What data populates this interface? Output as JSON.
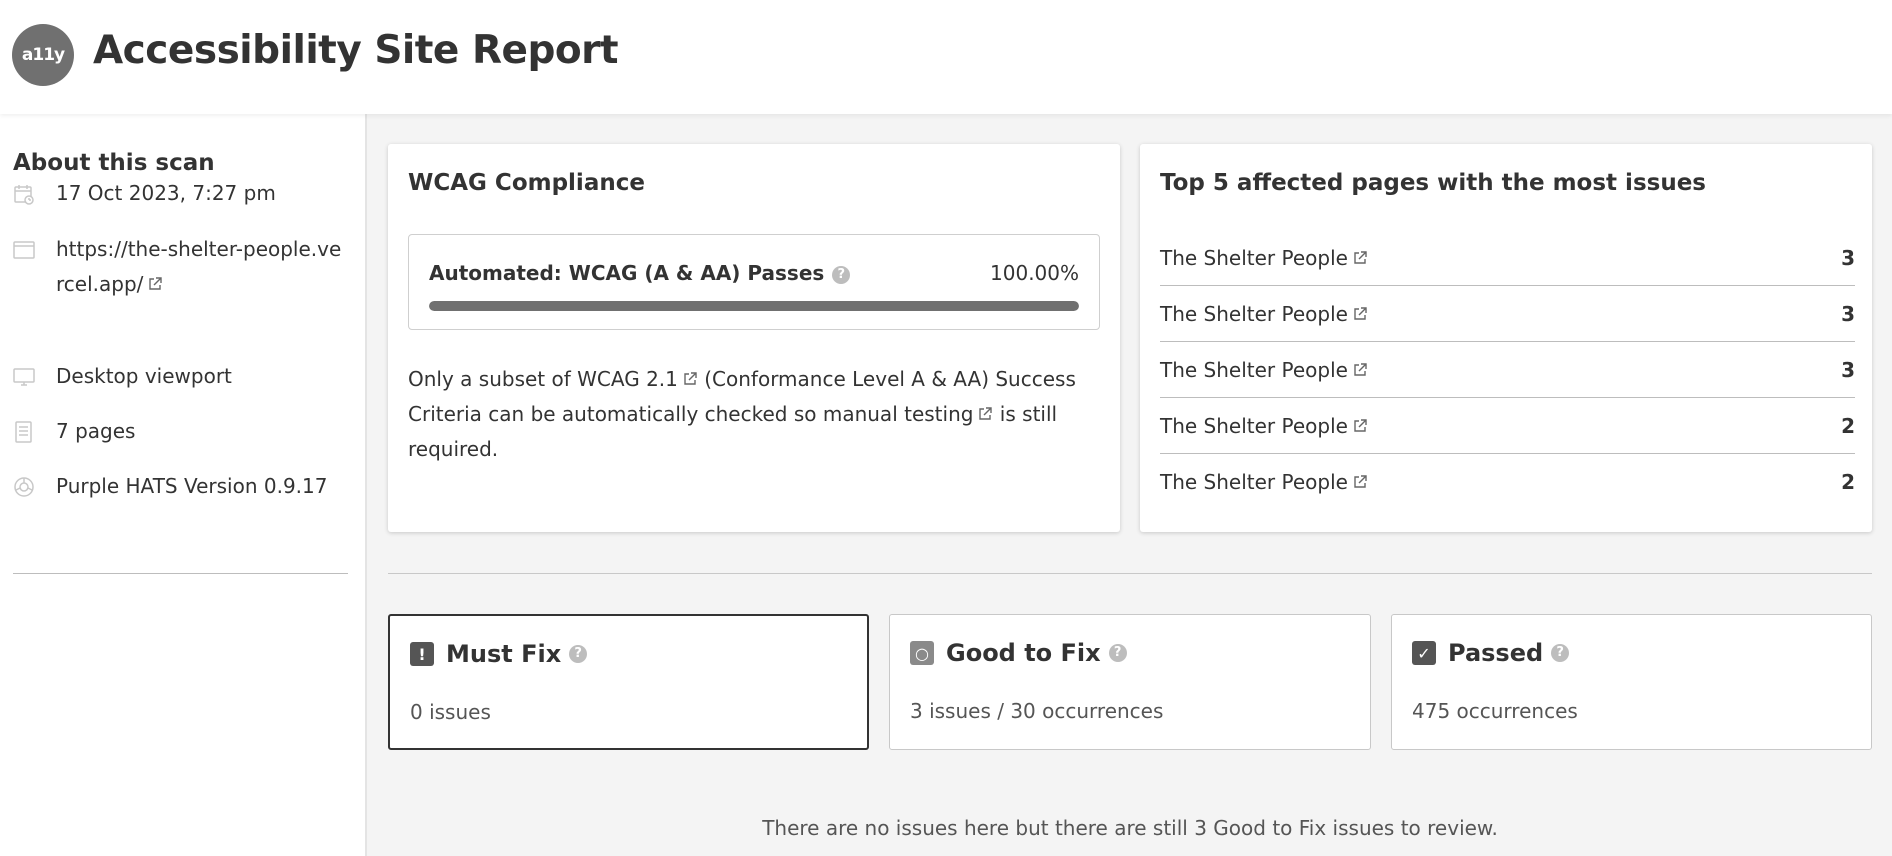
{
  "header": {
    "logo_text": "a11y",
    "title": "Accessibility Site Report"
  },
  "sidebar": {
    "title": "About this scan",
    "items": [
      {
        "icon": "calendar-icon",
        "text": "17 Oct 2023, 7:27 pm"
      },
      {
        "icon": "browser-window-icon",
        "text": "https://the-shelter-people.vercel.app/"
      },
      {
        "icon": "monitor-icon",
        "text": "Desktop viewport"
      },
      {
        "icon": "document-icon",
        "text": "7 pages"
      },
      {
        "icon": "hats-icon",
        "text": "Purple HATS Version 0.9.17"
      }
    ]
  },
  "wcag": {
    "title": "WCAG Compliance",
    "label": "Automated: WCAG (A & AA) Passes",
    "percent_text": "100.00%",
    "progress": 1.0,
    "note_part1": "Only a subset of ",
    "note_link1": "WCAG 2.1",
    "note_part2": " (Conformance Level A & AA) Success Criteria can be automatically checked so ",
    "note_link2": "manual testing",
    "note_part3": " is still required."
  },
  "top_pages": {
    "title": "Top 5 affected pages with the most issues",
    "rows": [
      {
        "name": "The Shelter People",
        "count": "3"
      },
      {
        "name": "The Shelter People",
        "count": "3"
      },
      {
        "name": "The Shelter People",
        "count": "3"
      },
      {
        "name": "The Shelter People",
        "count": "2"
      },
      {
        "name": "The Shelter People",
        "count": "2"
      }
    ]
  },
  "categories": [
    {
      "title": "Must Fix",
      "summary": "0 issues",
      "badge": "!",
      "color": "#555555"
    },
    {
      "title": "Good to Fix",
      "summary": "3 issues / 30 occurrences",
      "badge": "○",
      "color": "#8a8a8a"
    },
    {
      "title": "Passed",
      "summary": "475 occurrences",
      "badge": "✓",
      "color": "#555555"
    }
  ],
  "footer_message": "There are no issues here but there are still 3 Good to Fix issues to review."
}
